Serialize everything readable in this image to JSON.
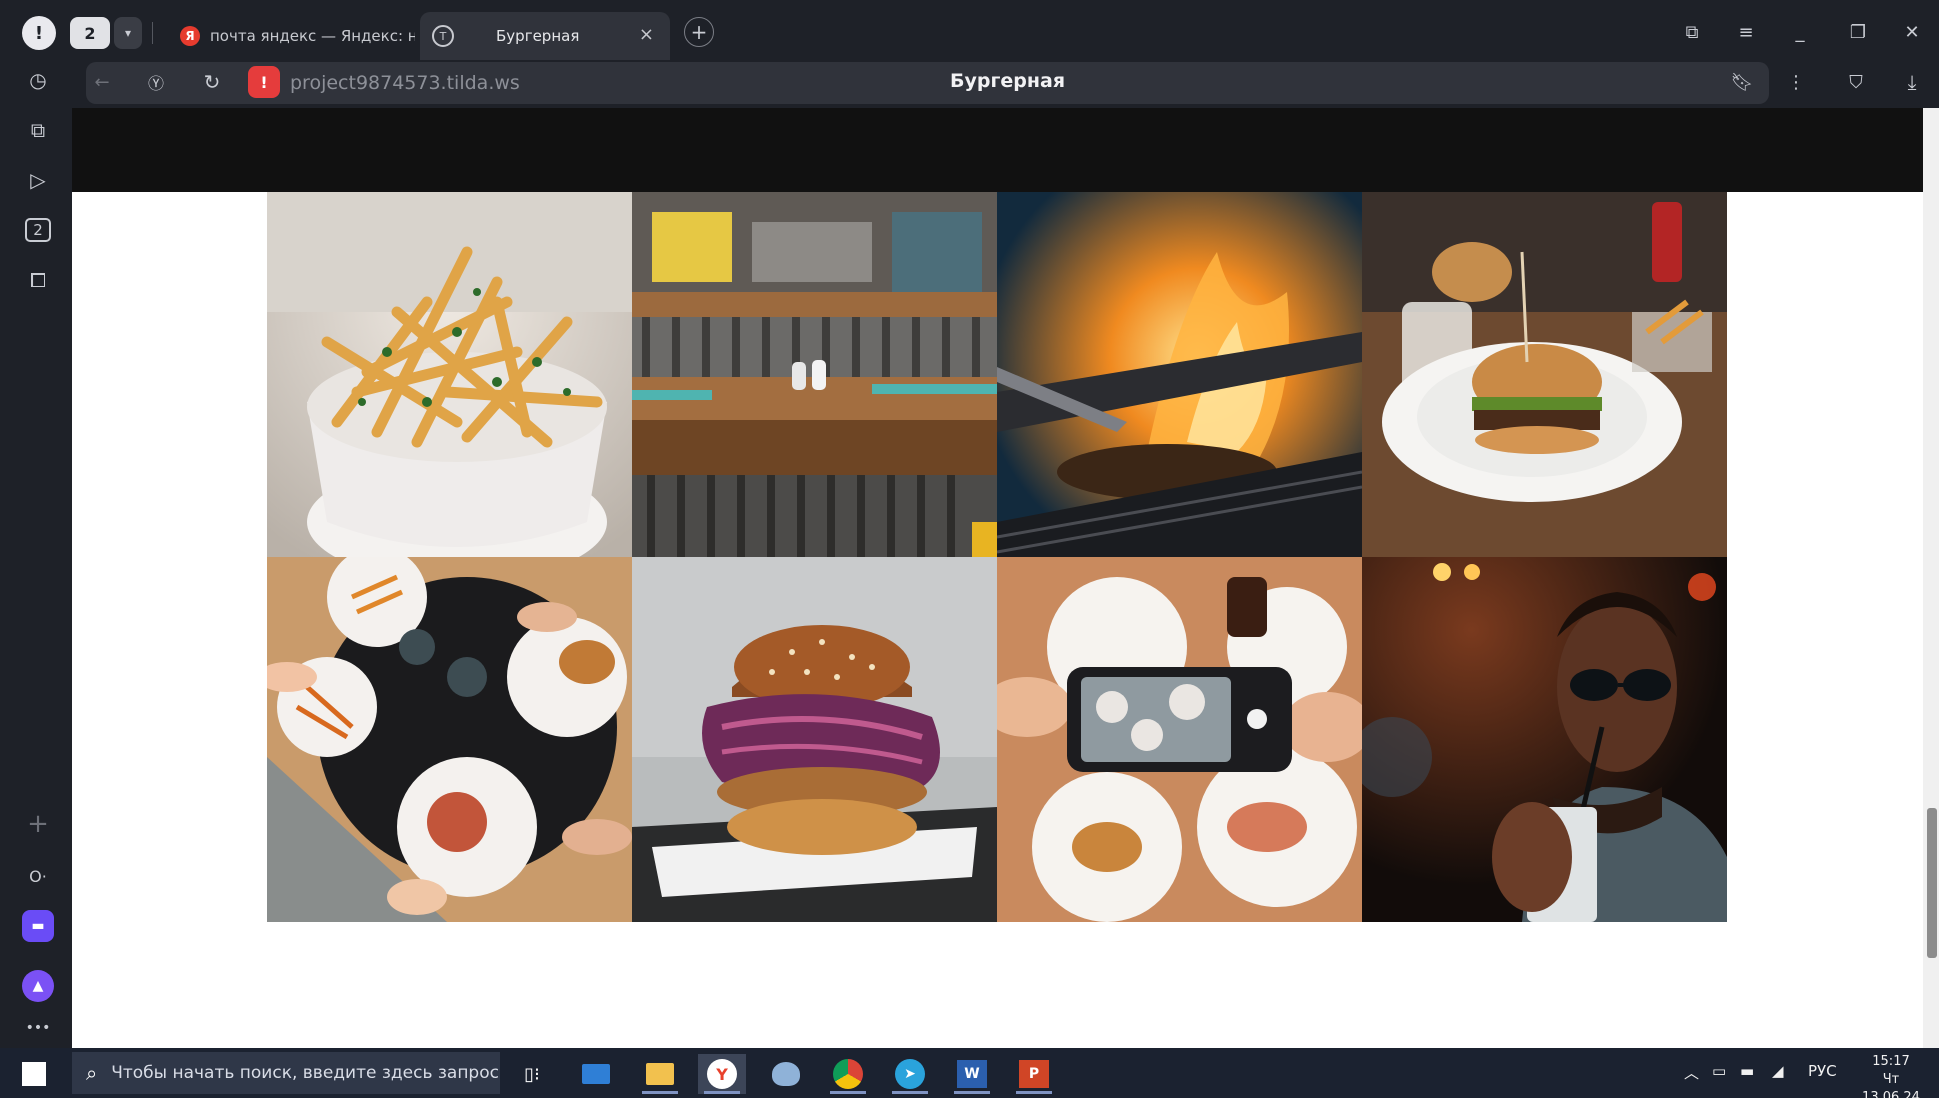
{
  "browser": {
    "tab_count": "2",
    "tabs": [
      {
        "title": "почта яндекс — Яндекс: н",
        "favicon": "yandex-icon"
      },
      {
        "title": "Бургерная",
        "favicon": "tilda-icon",
        "active": true
      }
    ],
    "profile_letter": "!",
    "address": {
      "url": "project9874573.tilda.ws",
      "page_title": "Бургерная"
    }
  },
  "sidebar": {
    "tab_badge": "2"
  },
  "page": {
    "gallery": [
      {
        "name": "french-fries",
        "alt": "French fries in a white bowl"
      },
      {
        "name": "restaurant-counter",
        "alt": "Wooden restaurant counter"
      },
      {
        "name": "grill-fire",
        "alt": "Meat on a flaming grill"
      },
      {
        "name": "burger-on-plate",
        "alt": "Burger on a white plate"
      },
      {
        "name": "table-top-view",
        "alt": "Friends eating burgers from above"
      },
      {
        "name": "big-burger",
        "alt": "Burger with red cabbage"
      },
      {
        "name": "phone-photo",
        "alt": "Taking a photo of food with a phone"
      },
      {
        "name": "man-drinking",
        "alt": "Man in sunglasses drinking"
      }
    ]
  },
  "taskbar": {
    "search_placeholder": "Чтобы начать поиск, введите здесь запрос",
    "lang": "РУС",
    "time": "15:17",
    "date": "Чт 13.06.24"
  },
  "colors": {
    "chrome": "#1e2128",
    "active_tab": "#30333b",
    "taskbar": "#1b2230",
    "page_dark": "#111111",
    "warning_red": "#e53c3c"
  }
}
